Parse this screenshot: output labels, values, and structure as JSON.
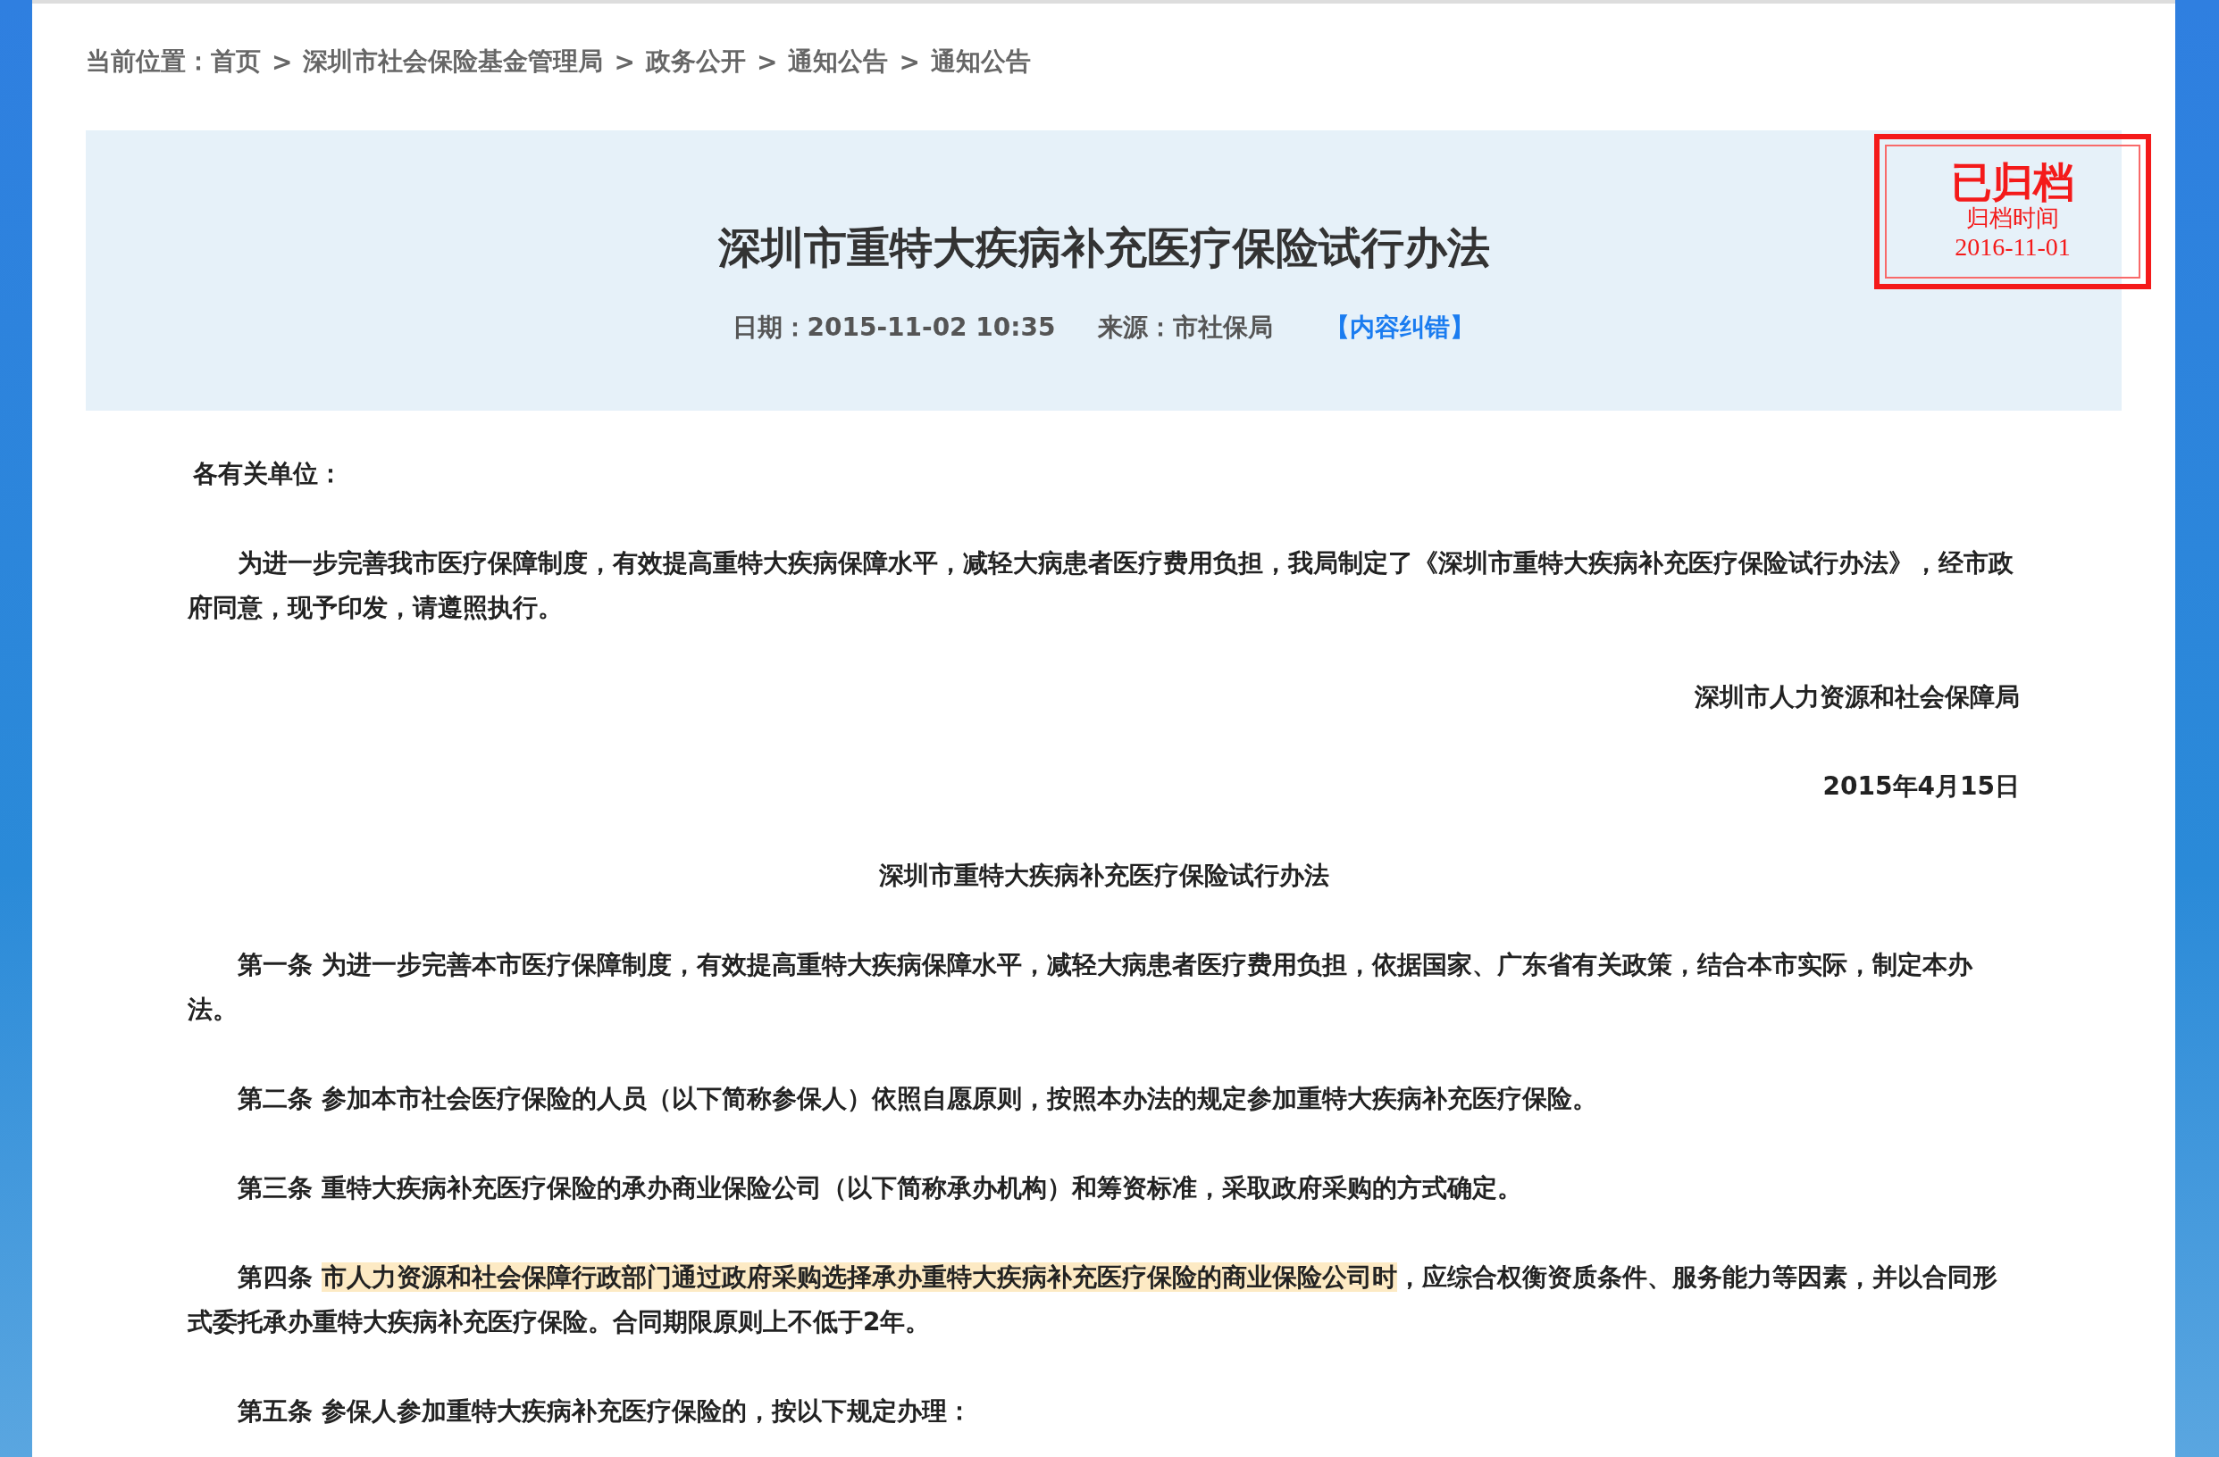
{
  "breadcrumb": {
    "label": "当前位置：",
    "items": [
      "首页",
      "深圳市社会保险基金管理局",
      "政务公开",
      "通知公告",
      "通知公告"
    ],
    "separator": ">"
  },
  "header": {
    "title": "深圳市重特大疾病补充医疗保险试行办法",
    "date": "日期：2015-11-02 10:35",
    "source": "来源：市社保局",
    "correction_link": "【内容纠错】"
  },
  "stamp": {
    "title": "已归档",
    "label": "归档时间",
    "date": "2016-11-01"
  },
  "body": [
    {
      "kind": "salutation",
      "segments": [
        {
          "text": "各有关单位：",
          "highlighted": false
        }
      ]
    },
    {
      "kind": "paragraph",
      "segments": [
        {
          "text": "为进一步完善我市医疗保障制度，有效提高重特大疾病保障水平，减轻大病患者医疗费用负担，我局制定了《深圳市重特大疾病补充医疗保险试行办法》，经市政府同意，现予印发，请遵照执行。",
          "highlighted": false
        }
      ]
    },
    {
      "kind": "signature",
      "segments": [
        {
          "text": "深圳市人力资源和社会保障局",
          "highlighted": false
        }
      ]
    },
    {
      "kind": "signature",
      "segments": [
        {
          "text": "2015年4月15日",
          "highlighted": false
        }
      ]
    },
    {
      "kind": "heading",
      "segments": [
        {
          "text": "深圳市重特大疾病补充医疗保险试行办法",
          "highlighted": false
        }
      ]
    },
    {
      "kind": "paragraph",
      "segments": [
        {
          "text": "第一条 为进一步完善本市医疗保障制度，有效提高重特大疾病保障水平，减轻大病患者医疗费用负担，依据国家、广东省有关政策，结合本市实际，制定本办法。",
          "highlighted": false
        }
      ]
    },
    {
      "kind": "paragraph",
      "segments": [
        {
          "text": "第二条 参加本市社会医疗保险的人员（以下简称参保人）依照自愿原则，按照本办法的规定参加重特大疾病补充医疗保险。",
          "highlighted": false
        }
      ]
    },
    {
      "kind": "paragraph",
      "segments": [
        {
          "text": "第三条 重特大疾病补充医疗保险的承办商业保险公司（以下简称承办机构）和筹资标准，采取政府采购的方式确定。",
          "highlighted": false
        }
      ]
    },
    {
      "kind": "paragraph",
      "segments": [
        {
          "text": "第四条 ",
          "highlighted": false
        },
        {
          "text": "市人力资源和社会保障行政部门通过政府采购选择承办重特大疾病补充医疗保险的商业保险公司时",
          "highlighted": true
        },
        {
          "text": "，应综合权衡资质条件、服务能力等因素，并以合同形式委托承办重特大疾病补充医疗保险。合同期限原则上不低于2年。",
          "highlighted": false
        }
      ]
    },
    {
      "kind": "paragraph",
      "segments": [
        {
          "text": "第五条 参保人参加重特大疾病补充医疗保险的，按以下规定办理：",
          "highlighted": false
        }
      ]
    }
  ]
}
